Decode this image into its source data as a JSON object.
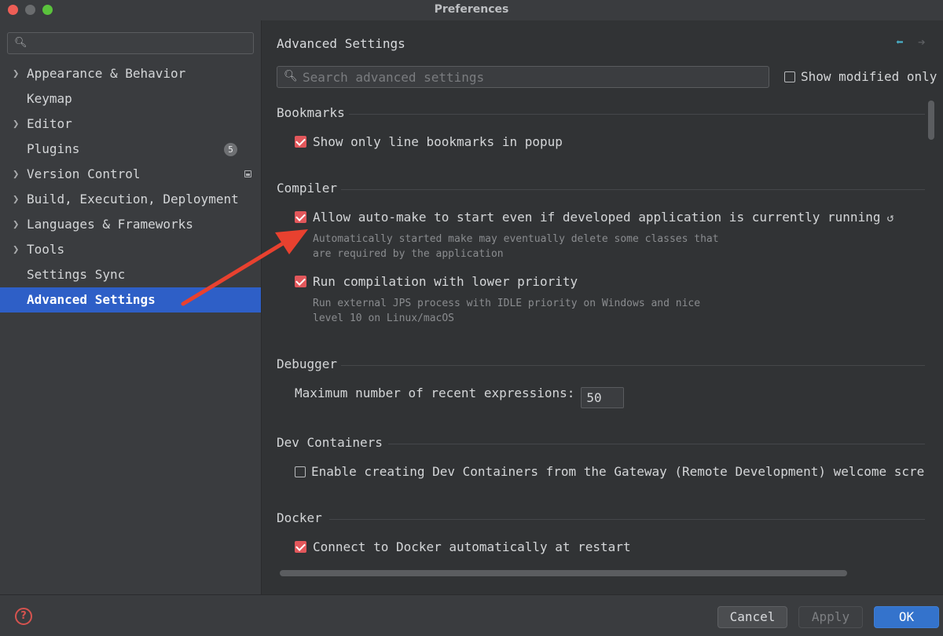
{
  "window": {
    "title": "Preferences"
  },
  "sidebar": {
    "search": {
      "value": "",
      "placeholder": ""
    },
    "items": [
      {
        "label": "Appearance & Behavior",
        "expandable": true
      },
      {
        "label": "Keymap",
        "expandable": false
      },
      {
        "label": "Editor",
        "expandable": true
      },
      {
        "label": "Plugins",
        "expandable": false,
        "badge": "5"
      },
      {
        "label": "Version Control",
        "expandable": true
      },
      {
        "label": "Build, Execution, Deployment",
        "expandable": true
      },
      {
        "label": "Languages & Frameworks",
        "expandable": true
      },
      {
        "label": "Tools",
        "expandable": true
      },
      {
        "label": "Settings Sync",
        "expandable": false
      },
      {
        "label": "Advanced Settings",
        "expandable": false,
        "selected": true
      }
    ]
  },
  "main": {
    "title": "Advanced Settings",
    "search": {
      "placeholder": "Search advanced settings",
      "value": ""
    },
    "show_modified_label": "Show modified only",
    "sections": {
      "bookmarks": {
        "title": "Bookmarks",
        "option1": {
          "label": "Show only line bookmarks in popup",
          "checked": true
        }
      },
      "compiler": {
        "title": "Compiler",
        "option1": {
          "label": "Allow auto-make to start even if developed application is currently running",
          "checked": true,
          "hint_line1": "Automatically started make may eventually delete some classes that",
          "hint_line2": "are required by the application"
        },
        "option2": {
          "label": "Run compilation with lower priority",
          "checked": true,
          "hint_line1": "Run external JPS process with IDLE priority on Windows and nice",
          "hint_line2": "level 10 on Linux/macOS"
        }
      },
      "debugger": {
        "title": "Debugger",
        "field_label": "Maximum number of recent expressions:",
        "field_value": "50"
      },
      "dev_containers": {
        "title": "Dev Containers",
        "option1": {
          "label": "Enable creating Dev Containers from the Gateway (Remote Development) welcome screen",
          "checked": false
        }
      },
      "docker": {
        "title": "Docker",
        "option1": {
          "label": "Connect to Docker automatically at restart",
          "checked": true
        }
      }
    }
  },
  "footer": {
    "help_glyph": "?",
    "cancel": "Cancel",
    "apply": "Apply",
    "ok": "OK"
  },
  "colors": {
    "accent": "#2e5fc7",
    "checkbox": "#e2575b",
    "annotation_arrow": "#e8412f"
  }
}
